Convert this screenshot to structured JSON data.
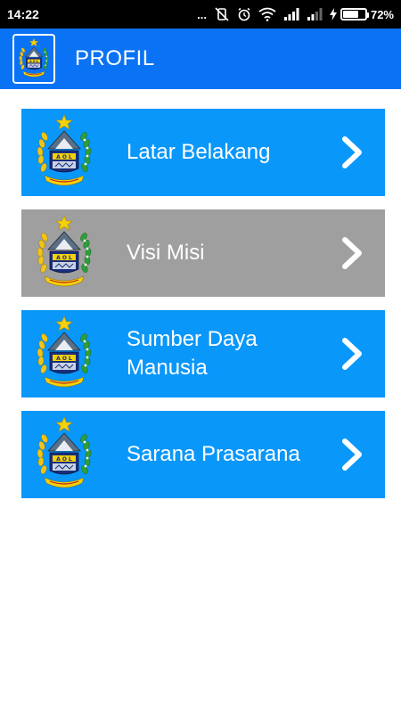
{
  "status_bar": {
    "time": "14:22",
    "dots": "...",
    "battery_percent": "72%",
    "battery_level": 0.72
  },
  "app_bar": {
    "title": "PROFIL",
    "logo_icon": "regional-emblem-icon"
  },
  "menu": {
    "items": [
      {
        "label": "Latar Belakang",
        "icon": "regional-emblem-icon",
        "state": "normal",
        "color": "#0a97fa"
      },
      {
        "label": "Visi Misi",
        "icon": "regional-emblem-icon",
        "state": "pressed",
        "color": "#9f9f9f"
      },
      {
        "label": "Sumber Daya\nManusia",
        "icon": "regional-emblem-icon",
        "state": "normal",
        "color": "#0a97fa"
      },
      {
        "label": "Sarana Prasarana",
        "icon": "regional-emblem-icon",
        "state": "normal",
        "color": "#0a97fa"
      }
    ]
  },
  "colors": {
    "app_bar": "#0a73f5",
    "item_blue": "#0a97fa",
    "item_pressed": "#9f9f9f"
  }
}
